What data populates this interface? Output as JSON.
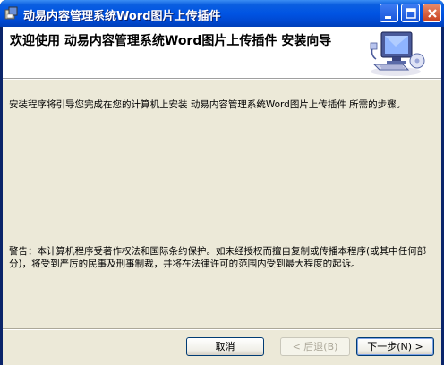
{
  "window": {
    "title": "动易内容管理系统Word图片上传插件"
  },
  "header": {
    "title": "欢迎使用 动易内容管理系统Word图片上传插件 安装向导"
  },
  "body": {
    "intro": "安装程序将引导您完成在您的计算机上安装 动易内容管理系统Word图片上传插件 所需的步骤。",
    "warning": "警告：本计算机程序受著作权法和国际条约保护。如未经授权而擅自复制或传播本程序(或其中任何部分)，将受到严厉的民事及刑事制裁，并将在法律许可的范围内受到最大程度的起诉。"
  },
  "buttons": {
    "cancel": "取消",
    "back": "< 后退(B)",
    "next": "下一步(N) >"
  },
  "icons": {
    "app": "installer-icon",
    "header": "computer-setup-icon"
  }
}
